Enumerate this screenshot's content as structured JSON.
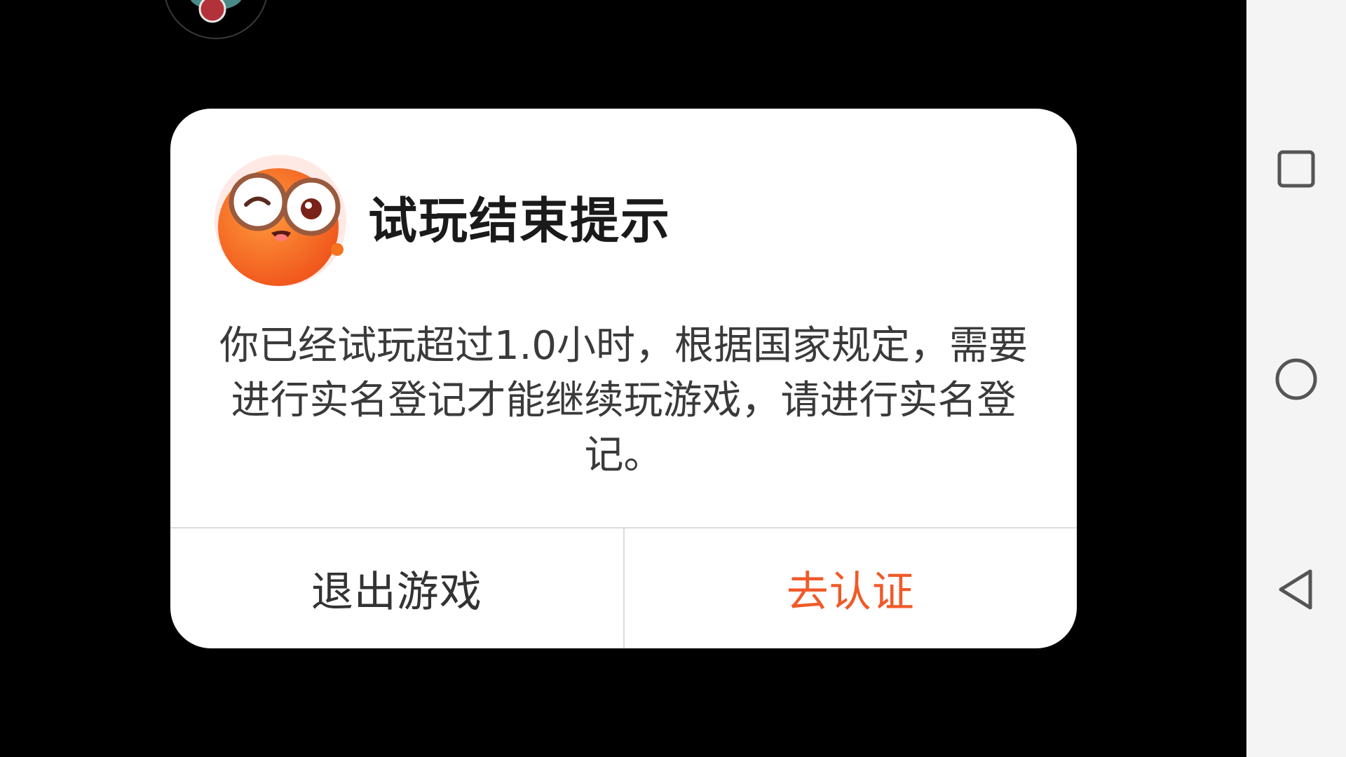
{
  "dialog": {
    "title": "试玩结束提示",
    "message": "你已经试玩超过1.0小时，根据国家规定，需要进行实名登记才能继续玩游戏，请进行实名登记。",
    "buttons": {
      "exit_label": "退出游戏",
      "verify_label": "去认证"
    }
  },
  "colors": {
    "backdrop": "#000000",
    "dialog_bg": "#ffffff",
    "accent": "#f05a28",
    "title_text": "#1a1a1a",
    "body_text": "#3a3a3a",
    "divider": "#dcdcdc",
    "nav_bar_bg": "#f4f4f4",
    "nav_icon": "#555555"
  },
  "icons": {
    "mascot": "mascot-icon",
    "floating_ball": "floating-ball-icon",
    "recents": "recents-icon",
    "home": "home-icon",
    "back": "back-icon"
  }
}
